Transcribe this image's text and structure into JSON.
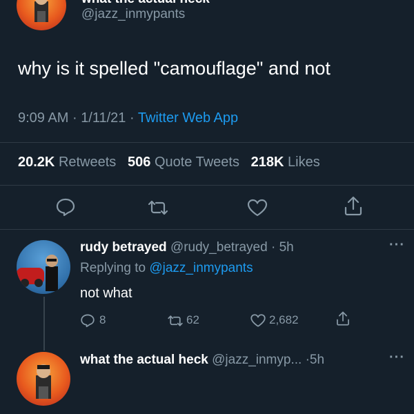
{
  "main_tweet": {
    "display_name_partial": "what the actual heck",
    "handle": "@jazz_inmypants",
    "text": "why is it spelled \"camouflage\" and not",
    "time": "9:09 AM",
    "date": "1/11/21",
    "source": "Twitter Web App",
    "stats": {
      "retweets_count": "20.2K",
      "retweets_label": "Retweets",
      "quotes_count": "506",
      "quotes_label": "Quote Tweets",
      "likes_count": "218K",
      "likes_label": "Likes"
    },
    "actions": [
      "reply-icon",
      "retweet-icon",
      "like-icon",
      "share-icon"
    ]
  },
  "reply": {
    "display_name": "rudy betrayed",
    "handle": "@rudy_betrayed",
    "age": "5h",
    "replying_to_label": "Replying to",
    "replying_to_handle": "@jazz_inmypants",
    "text": "not what",
    "replies": "8",
    "retweets": "62",
    "likes": "2,682"
  },
  "next_tweet": {
    "display_name": "what the actual heck",
    "handle": "@jazz_inmyp...",
    "age": "5h"
  },
  "colors": {
    "background": "#15202b",
    "accent": "#1d9bf0",
    "muted": "#8899a6"
  }
}
